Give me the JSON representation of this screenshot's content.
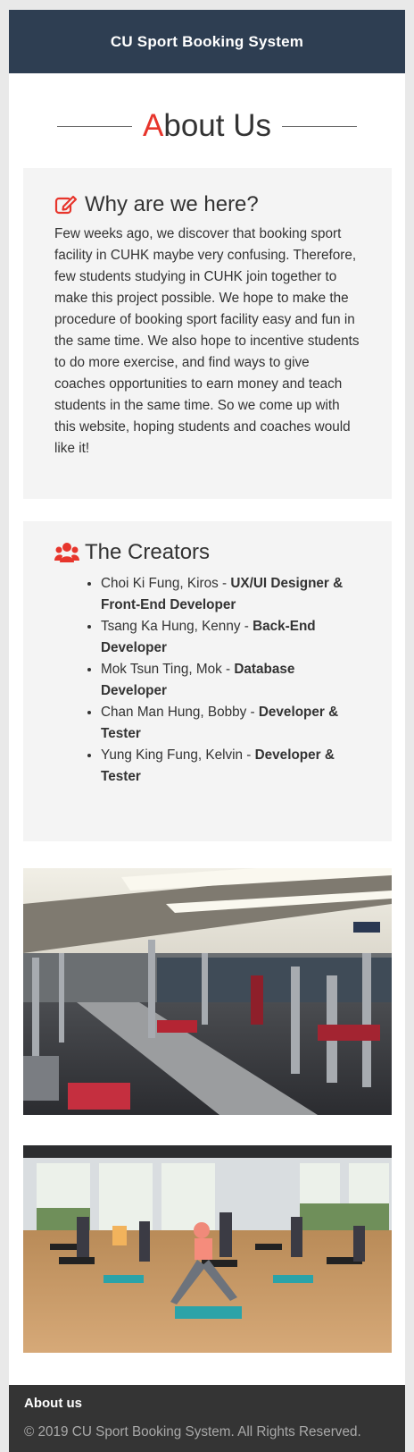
{
  "header": {
    "brand": "CU Sport Booking System"
  },
  "page": {
    "heading_first_letter": "A",
    "heading_rest": "bout Us"
  },
  "why": {
    "icon": "edit-icon",
    "title": "Why are we here?",
    "text": "Few weeks ago, we discover that booking sport facility in CUHK maybe very confusing. Therefore, few students studying in CUHK join together to make this project possible. We hope to make the procedure of booking sport facility easy and fun in the same time. We also hope to incentive students to do more exercise, and find ways to give coaches opportunities to earn money and teach students in the same time. So we come up with this website, hoping students and coaches would like it!"
  },
  "creators": {
    "icon": "users-icon",
    "title": "The Creators",
    "members": [
      {
        "name": "Choi Ki Fung, Kiros - ",
        "role": "UX/UI Designer & Front-End Developer"
      },
      {
        "name": "Tsang Ka Hung, Kenny - ",
        "role": "Back-End Developer"
      },
      {
        "name": "Mok Tsun Ting, Mok - ",
        "role": "Database Developer"
      },
      {
        "name": "Chan Man Hung, Bobby - ",
        "role": "Developer & Tester"
      },
      {
        "name": "Yung King Fung, Kelvin - ",
        "role": "Developer & Tester"
      }
    ]
  },
  "photos": [
    {
      "icon": "gym-equipment-photo"
    },
    {
      "icon": "fitness-class-photo"
    }
  ],
  "footer": {
    "title": "About us",
    "copyright": "© 2019 CU Sport Booking System. All Rights Reserved."
  },
  "colors": {
    "navbar": "#2e3e52",
    "accent": "#e7352c",
    "card": "#f4f4f4",
    "footer": "#343434"
  }
}
